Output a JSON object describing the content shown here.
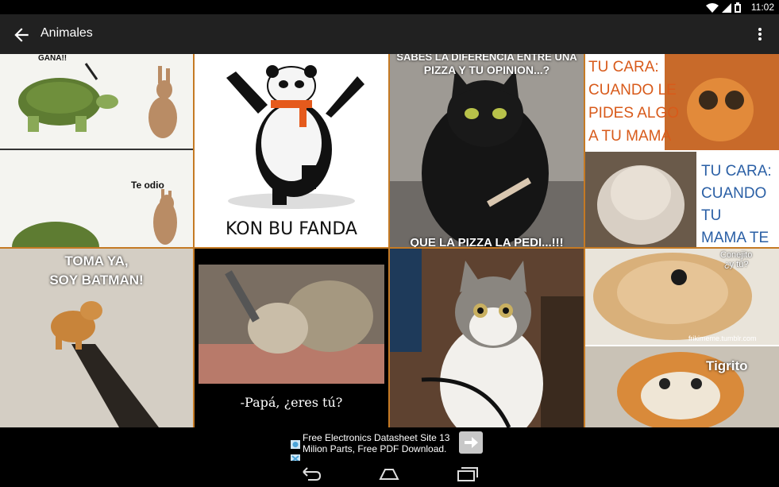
{
  "status_bar": {
    "time": "11:02",
    "icons": [
      "wifi-icon",
      "signal-icon",
      "battery-icon"
    ]
  },
  "app_bar": {
    "title": "Animales",
    "back_icon": "arrow-back-icon",
    "menu_icon": "more-vert-icon"
  },
  "memes": [
    {
      "name": "tortoise-hare",
      "top_text": "GANA!!",
      "bottom_text": "Te odio"
    },
    {
      "name": "kung-fu-panda",
      "caption": "KON BU FANDA"
    },
    {
      "name": "black-cat-pizza",
      "top_text_1": "SABES LA DIFERENCIA ENTRE UNA",
      "top_text_2": "PIZZA Y TU OPINION...?",
      "bottom_text": "QUE LA PIZZA LA PEDI...!!!"
    },
    {
      "name": "tu-cara-cats",
      "text_1": "TU CARA:\nCUANDO LE\nPIDES ALGO\nA TU MAMA",
      "text_2": "TU CARA:\nCUANDO TU\nMAMA TE\nPIDE ALGO"
    },
    {
      "name": "batman-dog",
      "caption_1": "TOMA YA,",
      "caption_2": "SOY BATMAN!"
    },
    {
      "name": "hedgehog-brush",
      "caption": "-Papá, ¿eres tú?"
    },
    {
      "name": "cat-desk",
      "caption": ""
    },
    {
      "name": "rabbit-tiger",
      "text_1": "Conejito\n¿y tú?",
      "watermark": "frikimeme.tumblr.com",
      "text_2": "Tigrito"
    }
  ],
  "ad": {
    "line_1": "Free Electronics Datasheet Site 13",
    "line_2": "Milion Parts, Free PDF Download."
  },
  "nav_bar": {
    "buttons": [
      "back-nav-icon",
      "home-nav-icon",
      "recents-nav-icon"
    ]
  }
}
